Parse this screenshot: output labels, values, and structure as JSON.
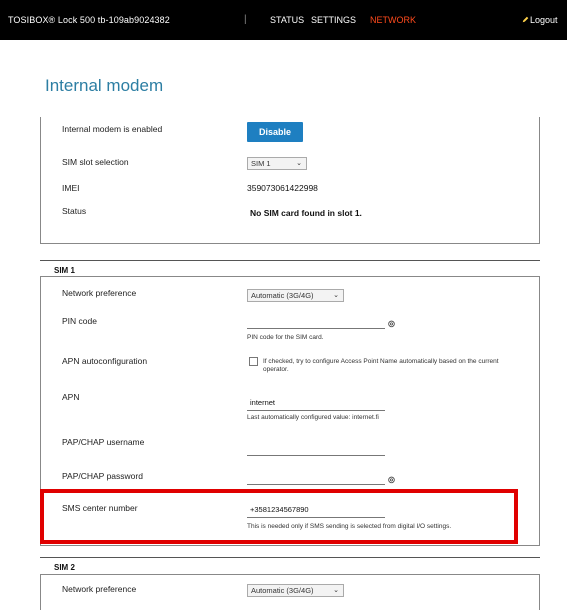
{
  "header": {
    "device": "TOSIBOX® Lock 500 tb-109ab9024382",
    "separator": "|",
    "nav": {
      "status": "STATUS",
      "settings": "SETTINGS",
      "network": "NETWORK"
    },
    "logout": "Logout",
    "accent_color": "#ff4a1c"
  },
  "page": {
    "title": "Internal modem"
  },
  "modem": {
    "enabled_label": "Internal modem is enabled",
    "disable_button": "Disable",
    "sim_slot_label": "SIM slot selection",
    "sim_slot_value": "SIM 1",
    "imei_label": "IMEI",
    "imei_value": "359073061422998",
    "status_label": "Status",
    "status_value": "No SIM card found in slot 1."
  },
  "sim1": {
    "header": "SIM 1",
    "network_pref_label": "Network preference",
    "network_pref_value": "Automatic (3G/4G)",
    "pin_label": "PIN code",
    "pin_value": "",
    "pin_hint": "PIN code for the SIM card.",
    "apn_auto_label": "APN autoconfiguration",
    "apn_auto_hint": "If checked, try to configure Access Point Name automatically based on the current operator.",
    "apn_label": "APN",
    "apn_value": "internet",
    "apn_hint": "Last automatically configured value: internet.fi",
    "pap_user_label": "PAP/CHAP username",
    "pap_user_value": "",
    "pap_pass_label": "PAP/CHAP password",
    "pap_pass_value": "",
    "sms_label": "SMS center number",
    "sms_value": "+3581234567890",
    "sms_hint": "This is needed only if SMS sending is selected from digital I/O settings."
  },
  "sim2": {
    "header": "SIM 2",
    "network_pref_label": "Network preference",
    "network_pref_value": "Automatic (3G/4G)"
  },
  "icons": {
    "eye": "eye-icon",
    "logout": "pencil-icon",
    "chevron": "chevron-down-icon"
  },
  "highlight_color": "#e00000",
  "button_color": "#1e7fc1",
  "title_color": "#2c7ea3"
}
